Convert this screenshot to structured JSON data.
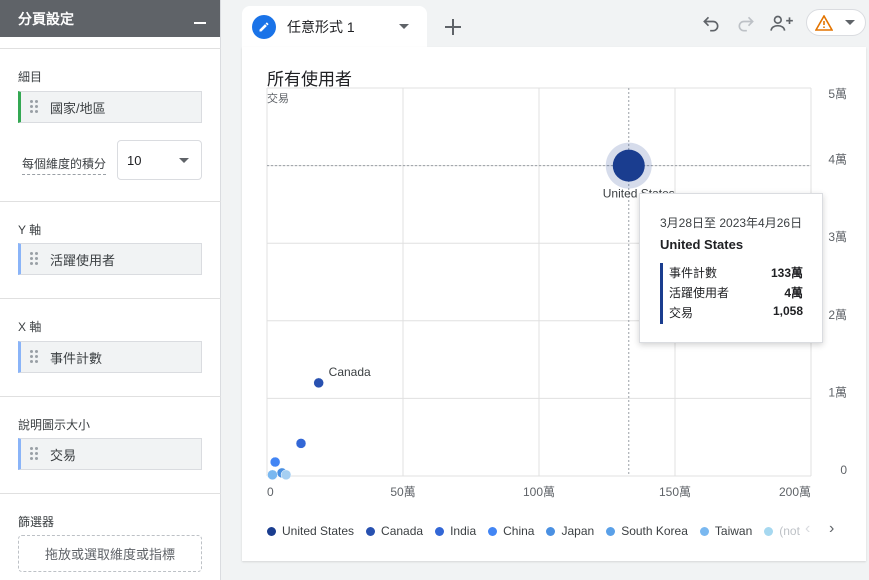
{
  "panel": {
    "title": "分頁設定",
    "breakdown": {
      "title": "細目",
      "chip": "國家/地區"
    },
    "granularity": {
      "label": "每個維度的積分",
      "value": "10"
    },
    "y_axis": {
      "title": "Y 軸",
      "chip": "活躍使用者"
    },
    "x_axis": {
      "title": "X 軸",
      "chip": "事件計數"
    },
    "bubble_size": {
      "title": "說明圖示大小",
      "chip": "交易"
    },
    "filters": {
      "title": "篩選器",
      "drop_zone": "拖放或選取維度或指標"
    }
  },
  "tab": {
    "label": "任意形式 1"
  },
  "toolbar": {
    "undo_icon": "undo-icon",
    "redo_icon": "redo-icon",
    "share_icon": "person-add-icon",
    "warning_icon": "warning-icon",
    "warning_color": "#e37400"
  },
  "chart_data": {
    "type": "scatter",
    "title": "所有使用者",
    "size_label": "交易",
    "xlim": [
      0,
      2000000
    ],
    "ylim": [
      0,
      50000
    ],
    "x_ticks": [
      {
        "value": 0,
        "label": "0"
      },
      {
        "value": 500000,
        "label": "50萬"
      },
      {
        "value": 1000000,
        "label": "100萬"
      },
      {
        "value": 1500000,
        "label": "150萬"
      },
      {
        "value": 2000000,
        "label": "200萬"
      }
    ],
    "y_ticks": [
      {
        "value": 0,
        "label": "0"
      },
      {
        "value": 10000,
        "label": "1萬"
      },
      {
        "value": 20000,
        "label": "2萬"
      },
      {
        "value": 30000,
        "label": "3萬"
      },
      {
        "value": 40000,
        "label": "4萬"
      },
      {
        "value": 50000,
        "label": "5萬"
      }
    ],
    "grid": true,
    "points": [
      {
        "name": "United States",
        "x": 1330000,
        "y": 40000,
        "size": 1058,
        "color": "#1a3d8f",
        "label": "United States"
      },
      {
        "name": "Canada",
        "x": 190000,
        "y": 12000,
        "size": 30,
        "color": "#2851b0",
        "label": "Canada"
      },
      {
        "name": "India",
        "x": 125000,
        "y": 4200,
        "size": 30,
        "color": "#3367d6"
      },
      {
        "name": "China",
        "x": 30000,
        "y": 1800,
        "size": 30,
        "color": "#4285f4"
      },
      {
        "name": "Japan",
        "x": 55000,
        "y": 400,
        "size": 20,
        "color": "#4a90e2"
      },
      {
        "name": "South Korea",
        "x": 20000,
        "y": 150,
        "size": 20,
        "color": "#7ab8f0"
      },
      {
        "name": "Taiwan",
        "x": 70000,
        "y": 150,
        "size": 20,
        "color": "#a6cff2"
      }
    ],
    "legend": [
      {
        "name": "United States",
        "color": "#1a3d8f"
      },
      {
        "name": "Canada",
        "color": "#2851b0"
      },
      {
        "name": "India",
        "color": "#3367d6"
      },
      {
        "name": "China",
        "color": "#4285f4"
      },
      {
        "name": "Japan",
        "color": "#4a90e2"
      },
      {
        "name": "South Korea",
        "color": "#5aa0e8"
      },
      {
        "name": "Taiwan",
        "color": "#7ab8f0"
      },
      {
        "name": "(not",
        "color": "#a6d8f0"
      }
    ],
    "crosshair": {
      "x": 1330000,
      "y": 40000
    }
  },
  "tooltip": {
    "date_range": "3月28日至 2023年4月26日",
    "country": "United States",
    "rows": [
      {
        "label": "事件計數",
        "value": "133萬"
      },
      {
        "label": "活躍使用者",
        "value": "4萬"
      },
      {
        "label": "交易",
        "value": "1,058"
      }
    ]
  }
}
